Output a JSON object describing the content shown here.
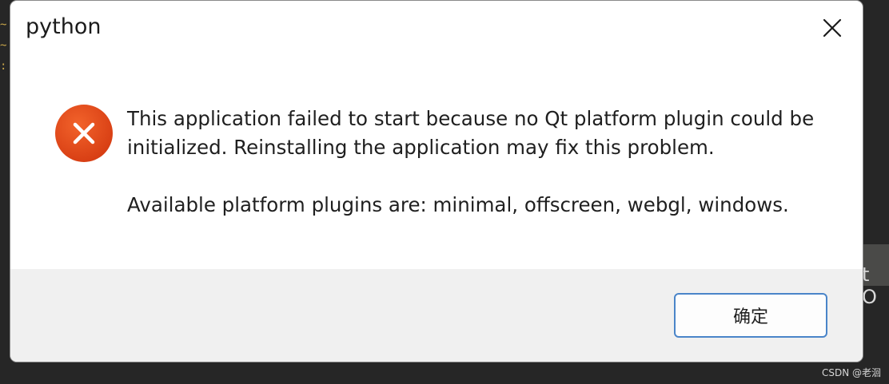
{
  "dialog": {
    "title": "python",
    "message_line1": "This application failed to start because no Qt platform plugin could be",
    "message_line2": "initialized. Reinstalling the application may fix this problem.",
    "message_line3": "Available platform plugins are: minimal, offscreen, webgl, windows.",
    "ok_label": "确定",
    "icon": "error-icon",
    "close_icon": "close-icon"
  },
  "background": {
    "right_glyph": "t O"
  },
  "watermark": {
    "text": "CSDN @老洄"
  },
  "colors": {
    "error_icon": "#e0481b",
    "button_border": "#4a85c9",
    "footer_bg": "#f0f0f0"
  }
}
